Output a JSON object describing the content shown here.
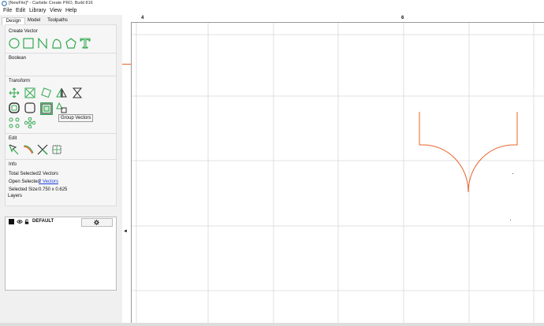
{
  "window": {
    "title": "[NewFile]* - Carbide Create PRO, Build 816",
    "icon": "carbide-app-icon"
  },
  "menu": [
    "File",
    "Edit",
    "Library",
    "View",
    "Help"
  ],
  "tabs": [
    {
      "label": "Design",
      "active": true
    },
    {
      "label": "Model",
      "active": false
    },
    {
      "label": "Toolpaths",
      "active": false
    }
  ],
  "sections": {
    "create_vector": "Create Vector",
    "boolean": "Boolean",
    "transform": "Transform",
    "edit": "Edit",
    "info": "Info",
    "layers": "Layers"
  },
  "create_vector_tools": [
    "circle-icon",
    "rectangle-icon",
    "polyline-icon",
    "curve-icon",
    "polygon-icon",
    "text-icon"
  ],
  "transform_tools": [
    "move-icon",
    "scale-icon",
    "rotate-icon",
    "mirror-icon",
    "align-icon",
    "offset-icon",
    "fillet-icon",
    "group-icon",
    "ungroup-icon",
    "array-icon",
    "circular-array-icon"
  ],
  "edit_tools": [
    "node-edit-icon",
    "knife-icon",
    "trim-icon",
    "join-icon"
  ],
  "tooltip": "Group Vectors",
  "info": {
    "total_selected_label": "Total Selected:",
    "total_selected_value": "2 Vectors",
    "open_selected_label": "Open Selected:",
    "open_selected_value": "2 Vectors",
    "selected_size_label": "Selected Size:",
    "selected_size_value": "0.750 x 0.625"
  },
  "layer": {
    "name": "DEFAULT",
    "color": "#111111"
  },
  "ruler": {
    "top_labels": [
      "4",
      "6"
    ]
  },
  "colors": {
    "accent_green": "#2fa84f",
    "vector_orange": "#e8632a",
    "grid": "#d8d8d8"
  }
}
